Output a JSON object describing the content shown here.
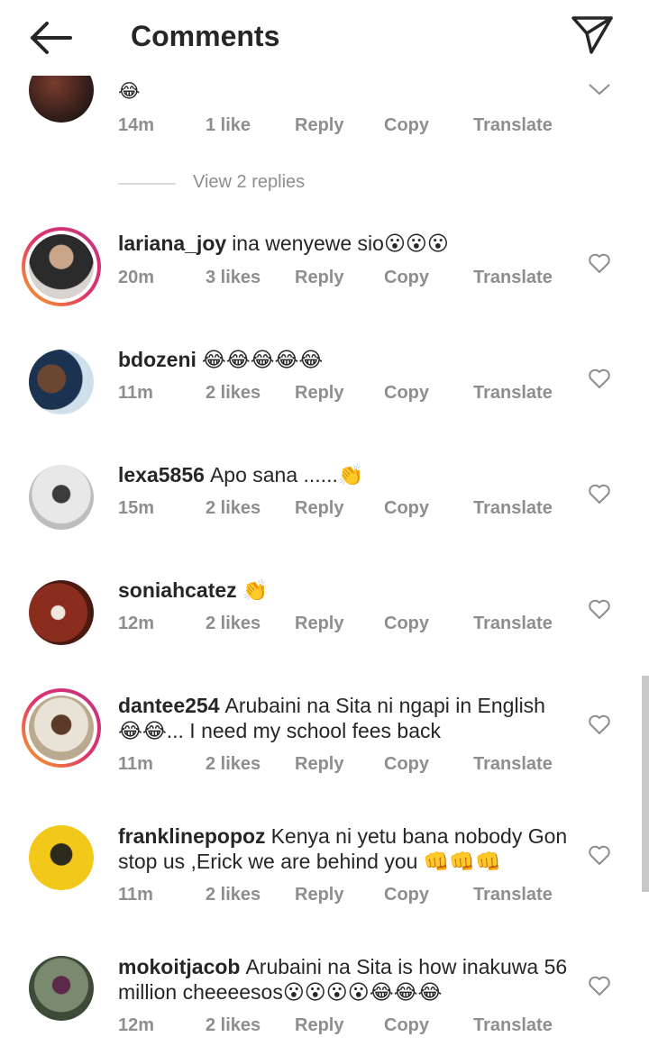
{
  "header": {
    "title": "Comments"
  },
  "first_partial": {
    "text": "😂",
    "time": "14m",
    "likes": "1 like",
    "reply": "Reply",
    "copy": "Copy",
    "translate": "Translate"
  },
  "view_replies": "View 2 replies",
  "comments": [
    {
      "user": "lariana_joy",
      "text": "ina wenyewe sio😮😮😮",
      "time": "20m",
      "likes": "3 likes",
      "reply": "Reply",
      "copy": "Copy",
      "translate": "Translate"
    },
    {
      "user": "bdozeni",
      "text": "😂😂😂😂😂",
      "time": "11m",
      "likes": "2 likes",
      "reply": "Reply",
      "copy": "Copy",
      "translate": "Translate"
    },
    {
      "user": "lexa5856",
      "text": "Apo sana ......👏",
      "time": "15m",
      "likes": "2 likes",
      "reply": "Reply",
      "copy": "Copy",
      "translate": "Translate"
    },
    {
      "user": "soniahcatez",
      "text": "👏",
      "time": "12m",
      "likes": "2 likes",
      "reply": "Reply",
      "copy": "Copy",
      "translate": "Translate"
    },
    {
      "user": "dantee254",
      "text": "Arubaini na Sita ni ngapi in English 😂😂... I need my school fees back",
      "time": "11m",
      "likes": "2 likes",
      "reply": "Reply",
      "copy": "Copy",
      "translate": "Translate"
    },
    {
      "user": "franklinepopoz",
      "text": "Kenya ni yetu bana nobody Gon stop us ,Erick we are behind you 👊👊👊",
      "time": "11m",
      "likes": "2 likes",
      "reply": "Reply",
      "copy": "Copy",
      "translate": "Translate"
    },
    {
      "user": "mokoitjacob",
      "text": "Arubaini na Sita is how inakuwa 56 million cheeeesos😮😮😮😮😂😂😂",
      "time": "12m",
      "likes": "2 likes",
      "reply": "Reply",
      "copy": "Copy",
      "translate": "Translate"
    }
  ],
  "colors": {
    "text": "#262626",
    "meta": "#8e8e8e",
    "ring_start": "#f9a825",
    "ring_end": "#c13584"
  },
  "icons": {
    "back": "arrow-left-icon",
    "send": "paper-plane-icon",
    "like": "heart-outline-icon",
    "collapse": "chevron-down-icon"
  }
}
